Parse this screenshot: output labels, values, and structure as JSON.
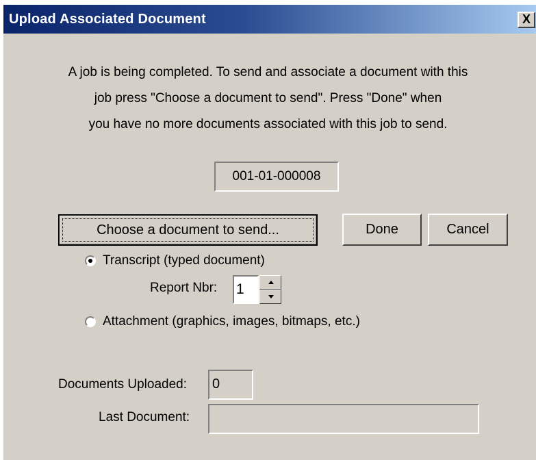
{
  "window": {
    "title": "Upload Associated Document",
    "close_glyph": "X"
  },
  "message": {
    "line1": "A job is being completed. To send and associate a document with this",
    "line2": "job press \"Choose a document to send\". Press \"Done\" when",
    "line3": "you have no more documents associated with this job to send."
  },
  "job_id": "001-01-000008",
  "buttons": {
    "choose": "Choose a document to send...",
    "done": "Done",
    "cancel": "Cancel"
  },
  "document_type": {
    "transcript_label": "Transcript (typed document)",
    "transcript_selected": true,
    "attachment_label": "Attachment (graphics, images, bitmaps, etc.)",
    "attachment_selected": false
  },
  "report_nbr": {
    "label": "Report Nbr:",
    "value": "1"
  },
  "status": {
    "uploaded_label": "Documents Uploaded:",
    "uploaded_value": "0",
    "last_doc_label": "Last Document:",
    "last_doc_value": ""
  },
  "colors": {
    "face": "#d4d0c8",
    "title_start": "#0a246a",
    "title_end": "#a6caf0"
  }
}
